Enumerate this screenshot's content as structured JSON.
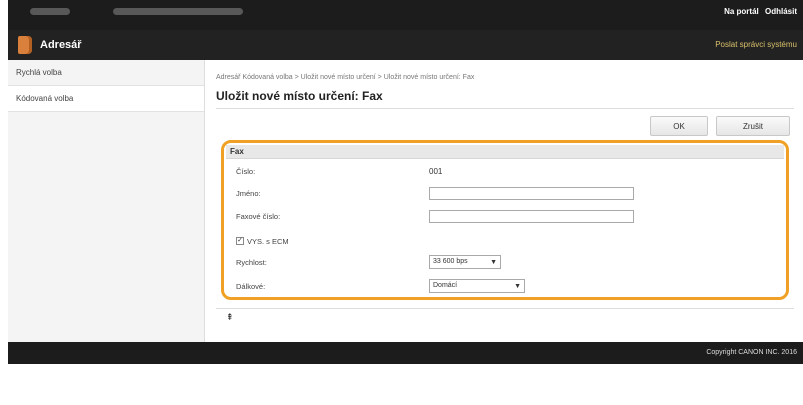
{
  "topbar": {
    "links": [
      "Na portál",
      "Odhlásit"
    ]
  },
  "app": {
    "title": "Adresář",
    "admin_link": "Poslat správci systému"
  },
  "sidebar": {
    "items": [
      {
        "label": "Rychlá volba"
      },
      {
        "label": "Kódovaná volba"
      }
    ]
  },
  "breadcrumb": "Adresář  Kódovaná volba > Uložit nové místo určení > Uložit nové místo určení: Fax",
  "page_title": "Uložit nové místo určení: Fax",
  "buttons": {
    "ok": "OK",
    "cancel": "Zrušit"
  },
  "form": {
    "section": "Fax",
    "number_label": "Číslo:",
    "number_value": "001",
    "name_label": "Jméno:",
    "name_value": "",
    "fax_label": "Faxové číslo:",
    "fax_value": "",
    "ecm_label": "VYS. s ECM",
    "ecm_checked": true,
    "speed_label": "Rychlost:",
    "speed_value": "33 600 bps",
    "distance_label": "Dálkové:",
    "distance_value": "Domácí"
  },
  "footer": {
    "copyright": "Copyright CANON INC. 2016"
  },
  "colors": {
    "highlight": "#f0a024",
    "topbar": "#1c1c1c",
    "accent": "#d9803c"
  }
}
